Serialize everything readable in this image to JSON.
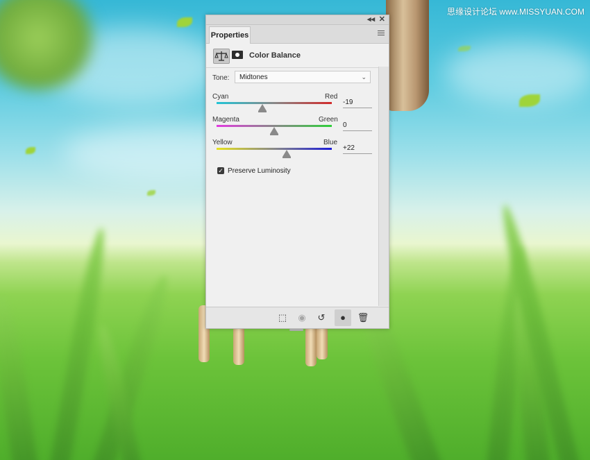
{
  "watermark": "思缘设计论坛 www.MISSYUAN.COM",
  "window_controls": {
    "collapse": "◂◂",
    "close": "✕"
  },
  "panel": {
    "tab_label": "Properties",
    "menu_icon": "panel-menu-icon",
    "adjustment_icon": "balance-scale-icon",
    "mask_icon": "layer-mask-icon",
    "title": "Color Balance"
  },
  "tone": {
    "label": "Tone:",
    "value": "Midtones"
  },
  "sliders": [
    {
      "left": "Cyan",
      "right": "Red",
      "value": "-19",
      "fraction": 0.4,
      "colors": [
        "#22c4d6",
        "#d22a2a"
      ]
    },
    {
      "left": "Magenta",
      "right": "Green",
      "value": "0",
      "fraction": 0.5,
      "colors": [
        "#e23ae0",
        "#2fcf3a"
      ]
    },
    {
      "left": "Yellow",
      "right": "Blue",
      "value": "+22",
      "fraction": 0.61,
      "colors": [
        "#e6e21e",
        "#1b1bd8"
      ]
    }
  ],
  "preserve": {
    "label": "Preserve Luminosity",
    "checked": true
  },
  "footer_buttons": [
    {
      "name": "clip-to-layer-icon",
      "glyph": "⬚",
      "state": "normal"
    },
    {
      "name": "view-previous-state-icon",
      "glyph": "◉",
      "state": "disabled"
    },
    {
      "name": "reset-icon",
      "glyph": "↺",
      "state": "normal"
    },
    {
      "name": "visibility-eye-icon",
      "glyph": "●",
      "state": "active"
    },
    {
      "name": "trash-icon",
      "glyph": "🗑",
      "state": "normal"
    }
  ]
}
